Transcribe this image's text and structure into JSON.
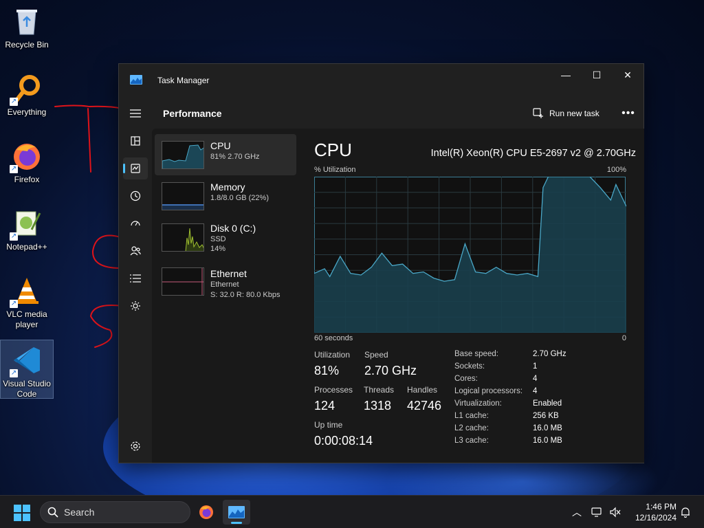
{
  "desktop": {
    "icons": [
      {
        "label": "Recycle Bin"
      },
      {
        "label": "Everything"
      },
      {
        "label": "Firefox"
      },
      {
        "label": "Notepad++"
      },
      {
        "label": "VLC media player"
      },
      {
        "label": "Visual Studio Code"
      }
    ],
    "annotation_color": "#e0141a"
  },
  "window": {
    "title": "Task Manager",
    "controls": {
      "minimize": "—",
      "maximize": "☐",
      "close": "✕"
    }
  },
  "sidebar": {
    "items": [
      {
        "icon": "hamburger-icon"
      },
      {
        "icon": "processes-icon"
      },
      {
        "icon": "performance-icon",
        "active": true
      },
      {
        "icon": "app-history-icon"
      },
      {
        "icon": "startup-apps-icon"
      },
      {
        "icon": "users-icon"
      },
      {
        "icon": "details-icon"
      },
      {
        "icon": "services-icon"
      },
      {
        "icon": "settings-icon"
      }
    ]
  },
  "header": {
    "title": "Performance",
    "run_task": "Run new task",
    "more": "•••"
  },
  "resources": [
    {
      "name": "CPU",
      "sub1": "81% 2.70 GHz",
      "sub2": ""
    },
    {
      "name": "Memory",
      "sub1": "1.8/8.0 GB (22%)",
      "sub2": ""
    },
    {
      "name": "Disk 0 (C:)",
      "sub1": "SSD",
      "sub2": "14%"
    },
    {
      "name": "Ethernet",
      "sub1": "Ethernet",
      "sub2": "S: 32.0  R: 80.0 Kbps"
    }
  ],
  "detail": {
    "title": "CPU",
    "model": "Intel(R) Xeon(R) CPU E5-2697 v2 @ 2.70GHz",
    "graph": {
      "label_tl": "% Utilization",
      "label_tr": "100%",
      "label_bl": "60 seconds",
      "label_br": "0",
      "line_color": "#4aa8c8",
      "fill_color": "#1a3f4d"
    },
    "stats": {
      "utilization_label": "Utilization",
      "utilization": "81%",
      "speed_label": "Speed",
      "speed": "2.70 GHz",
      "processes_label": "Processes",
      "processes": "124",
      "threads_label": "Threads",
      "threads": "1318",
      "handles_label": "Handles",
      "handles": "42746",
      "uptime_label": "Up time",
      "uptime": "0:00:08:14"
    },
    "specs": [
      {
        "k": "Base speed:",
        "v": "2.70 GHz"
      },
      {
        "k": "Sockets:",
        "v": "1"
      },
      {
        "k": "Cores:",
        "v": "4"
      },
      {
        "k": "Logical processors:",
        "v": "4"
      },
      {
        "k": "Virtualization:",
        "v": "Enabled"
      },
      {
        "k": "L1 cache:",
        "v": "256 KB"
      },
      {
        "k": "L2 cache:",
        "v": "16.0 MB"
      },
      {
        "k": "L3 cache:",
        "v": "16.0 MB"
      }
    ]
  },
  "chart_data": {
    "type": "area",
    "title": "",
    "xlabel": "60 seconds",
    "ylabel": "% Utilization",
    "ylim": [
      0,
      100
    ],
    "x": [
      60,
      58,
      57,
      55,
      53,
      51,
      49,
      47,
      45,
      43,
      41,
      39,
      37,
      35,
      33,
      31,
      29,
      27,
      25,
      23,
      21,
      19,
      17,
      16,
      15,
      13,
      11,
      9,
      7,
      5,
      3,
      2,
      1,
      0
    ],
    "series": [
      {
        "values": [
          38,
          41,
          36,
          49,
          38,
          37,
          42,
          51,
          43,
          44,
          38,
          39,
          35,
          33,
          34,
          57,
          39,
          38,
          42,
          38,
          37,
          38,
          36,
          93,
          100,
          100,
          100,
          100,
          100,
          93,
          85,
          95,
          88,
          81
        ]
      }
    ]
  },
  "taskbar": {
    "search_placeholder": "Search",
    "time": "1:46 PM",
    "date": "12/16/2024"
  }
}
